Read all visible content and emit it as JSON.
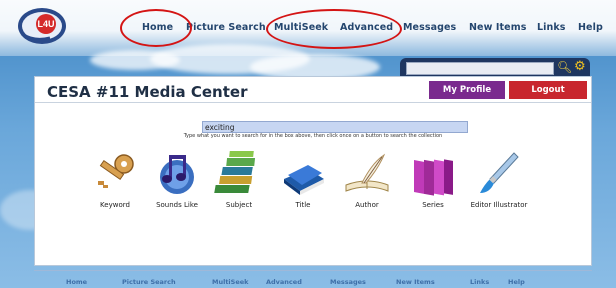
{
  "top_nav": [
    {
      "label": "Home"
    },
    {
      "label": "Picture Search"
    },
    {
      "label": "MultiSeek"
    },
    {
      "label": "Advanced"
    },
    {
      "label": "Messages"
    },
    {
      "label": "New Items"
    },
    {
      "label": "Links"
    },
    {
      "label": "Help"
    }
  ],
  "header": {
    "title": "CESA #11 Media Center",
    "my_profile": "My Profile",
    "logout": "Logout"
  },
  "search": {
    "value": "exciting",
    "instructions": "Type what you want to search for in the box above, then click once on a button to search the collection"
  },
  "search_buttons": [
    {
      "label": "Keyword",
      "icon": "key-icon"
    },
    {
      "label": "Sounds Like",
      "icon": "music-notes-icon"
    },
    {
      "label": "Subject",
      "icon": "stacked-books-icon"
    },
    {
      "label": "Title",
      "icon": "blue-book-icon"
    },
    {
      "label": "Author",
      "icon": "quill-book-icon"
    },
    {
      "label": "Series",
      "icon": "book-series-icon"
    },
    {
      "label": "Editor Illustrator",
      "icon": "paintbrush-icon"
    }
  ],
  "bottom_nav": [
    {
      "label": "Home"
    },
    {
      "label": "Picture Search"
    },
    {
      "label": "MultiSeek"
    },
    {
      "label": "Advanced"
    },
    {
      "label": "Messages"
    },
    {
      "label": "New Items"
    },
    {
      "label": "Links"
    },
    {
      "label": "Help"
    }
  ],
  "colors": {
    "header_bg": "#1e3660",
    "profile_button": "#7a2a8e",
    "logout_button": "#c8262e",
    "annotation_ring": "#d41414",
    "nav_text": "#24466e"
  }
}
